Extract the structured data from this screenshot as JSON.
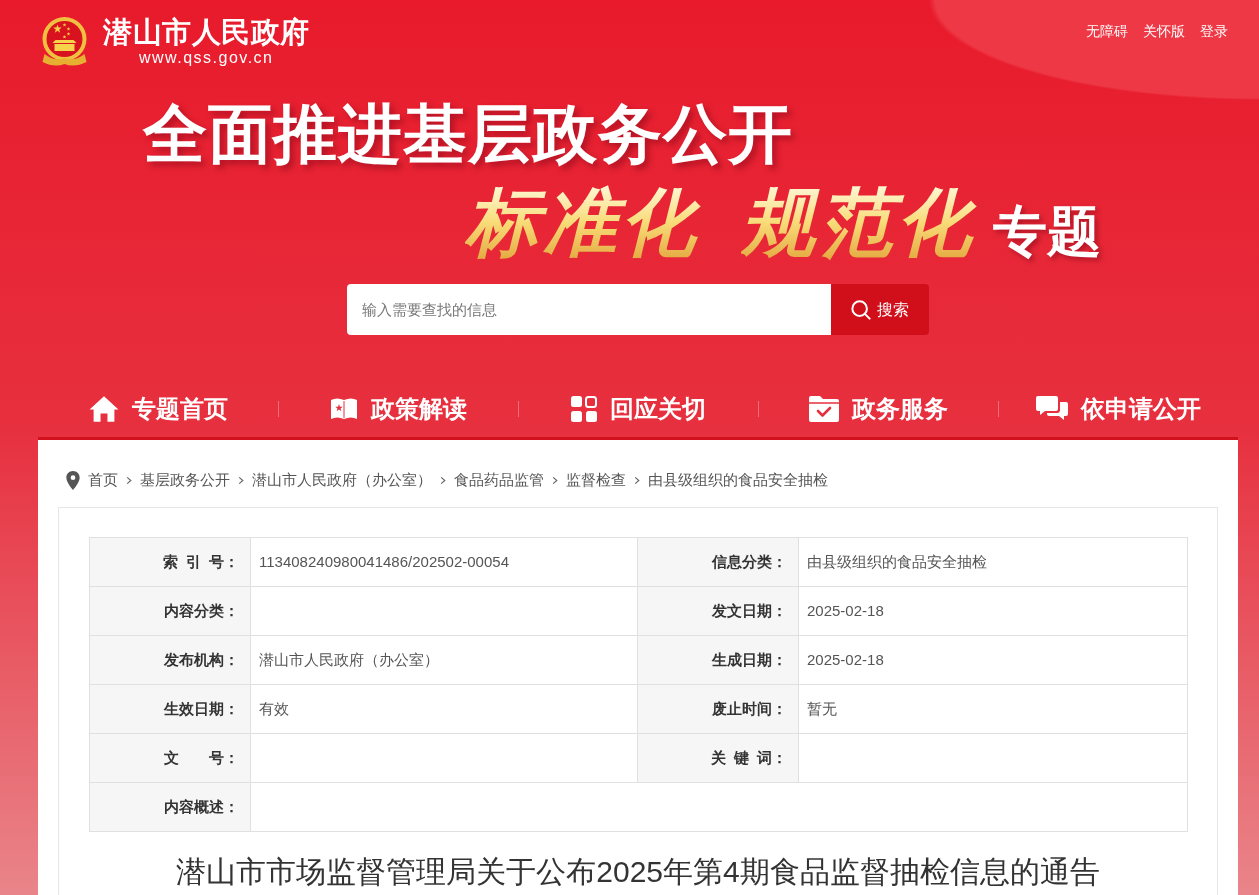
{
  "header": {
    "site_name": "潜山市人民政府",
    "site_url": "www.qss.gov.cn",
    "links": [
      "无障碍",
      "关怀版",
      "登录"
    ]
  },
  "banner": {
    "headline": "全面推进基层政务公开",
    "tagline": [
      {
        "text": "标准化",
        "kind": "script"
      },
      {
        "text": "规范化",
        "kind": "script"
      },
      {
        "text": "专题",
        "kind": "plain"
      }
    ]
  },
  "search": {
    "placeholder": "输入需要查找的信息",
    "button": "搜索"
  },
  "nav": [
    "专题首页",
    "政策解读",
    "回应关切",
    "政务服务",
    "依申请公开"
  ],
  "breadcrumb": [
    "首页",
    "基层政务公开",
    "潜山市人民政府（办公室）",
    "食品药品监管",
    "监督检查",
    "由县级组织的食品安全抽检"
  ],
  "info_table": {
    "rows": [
      [
        {
          "label": "索 引 号：",
          "value": "113408240980041486/202502-00054"
        },
        {
          "label": "信息分类：",
          "value": "由县级组织的食品安全抽检"
        }
      ],
      [
        {
          "label": "内容分类："
        },
        {
          "label": "发文日期：",
          "value": "2025-02-18"
        }
      ],
      [
        {
          "label": "发布机构：",
          "value": "潜山市人民政府（办公室）"
        },
        {
          "label": "生成日期：",
          "value": "2025-02-18"
        }
      ],
      [
        {
          "label": "生效日期：",
          "value": "有效"
        },
        {
          "label": "废止时间：",
          "value": "暂无"
        }
      ],
      [
        {
          "label": "文　　号："
        },
        {
          "label": "关 键 词："
        }
      ],
      [
        {
          "label": "内容概述："
        }
      ]
    ]
  },
  "article": {
    "title": "潜山市市场监督管理局关于公布2025年第4期食品监督抽检信息的通告"
  }
}
